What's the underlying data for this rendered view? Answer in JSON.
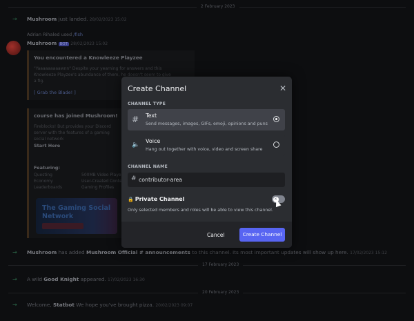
{
  "background": {
    "date_dividers": [
      "2 February 2023",
      "17 February 2023",
      "20 February 2023"
    ],
    "messages": [
      {
        "author": "Mushroom",
        "text": "just landed.",
        "time": "28/02/2023 15:02"
      },
      {
        "meta": "Adrian Rihaled used ",
        "ref": "/fish"
      },
      {
        "author": "Mushroom",
        "badge": "BOT",
        "time": "28/02/2023 15:02"
      },
      {
        "card_title": "You encountered a Knowleeze Playzee",
        "card_text": "\"Yaaaaaaaaawnn\" Despite your yearning for answers and this Knowleeze Playzee's abundance of them, he doesn't seem to give a fig.",
        "card_link": "[ Grab the Blade! ]"
      },
      {
        "card_title": "course has joined Mushroom!",
        "card_text": "Fireblocks! But provides your Discord server with the features of a gaming social network",
        "card_sub": "Start Here",
        "card_features_title": "Featuring:",
        "features": [
          "Questing",
          "Economy",
          "Leaderboards",
          "500MB Video Player",
          "User-Created Content",
          "Gaming Profiles"
        ]
      },
      {
        "author": "Mushroom",
        "text": "has added",
        "target": "Mushroom Official #",
        "channel": "announcements",
        "rest": "to this channel. Its most important updates will show up here.",
        "time": "17/02/2023 15:12"
      },
      {
        "text": "A wild",
        "author": "Good Knight",
        "rest": "appeared.",
        "time": "17/02/2023 16:30"
      },
      {
        "text": "Welcome,",
        "author": "Statbot",
        "rest": "We hope you've brought pizza.",
        "time": "20/02/2023 09:07"
      }
    ],
    "art_title": "The Gaming Social Network"
  },
  "modal": {
    "title": "Create Channel",
    "channel_type_label": "CHANNEL TYPE",
    "options": [
      {
        "icon": "hash-icon",
        "glyph": "#",
        "name": "Text",
        "desc": "Send messages, images, GIFs, emoji, opinions and puns",
        "selected": true
      },
      {
        "icon": "speaker-icon",
        "glyph": "🔈",
        "name": "Voice",
        "desc": "Hang out together with voice, video and screen share",
        "selected": false
      }
    ],
    "channel_name_label": "CHANNEL NAME",
    "channel_name_value": "contributor-area",
    "private_label": "Private Channel",
    "private_enabled": false,
    "private_hint": "Only selected members and roles will be able to view this channel.",
    "cancel_label": "Cancel",
    "create_label": "Create Channel",
    "accent": "#5865f2"
  }
}
